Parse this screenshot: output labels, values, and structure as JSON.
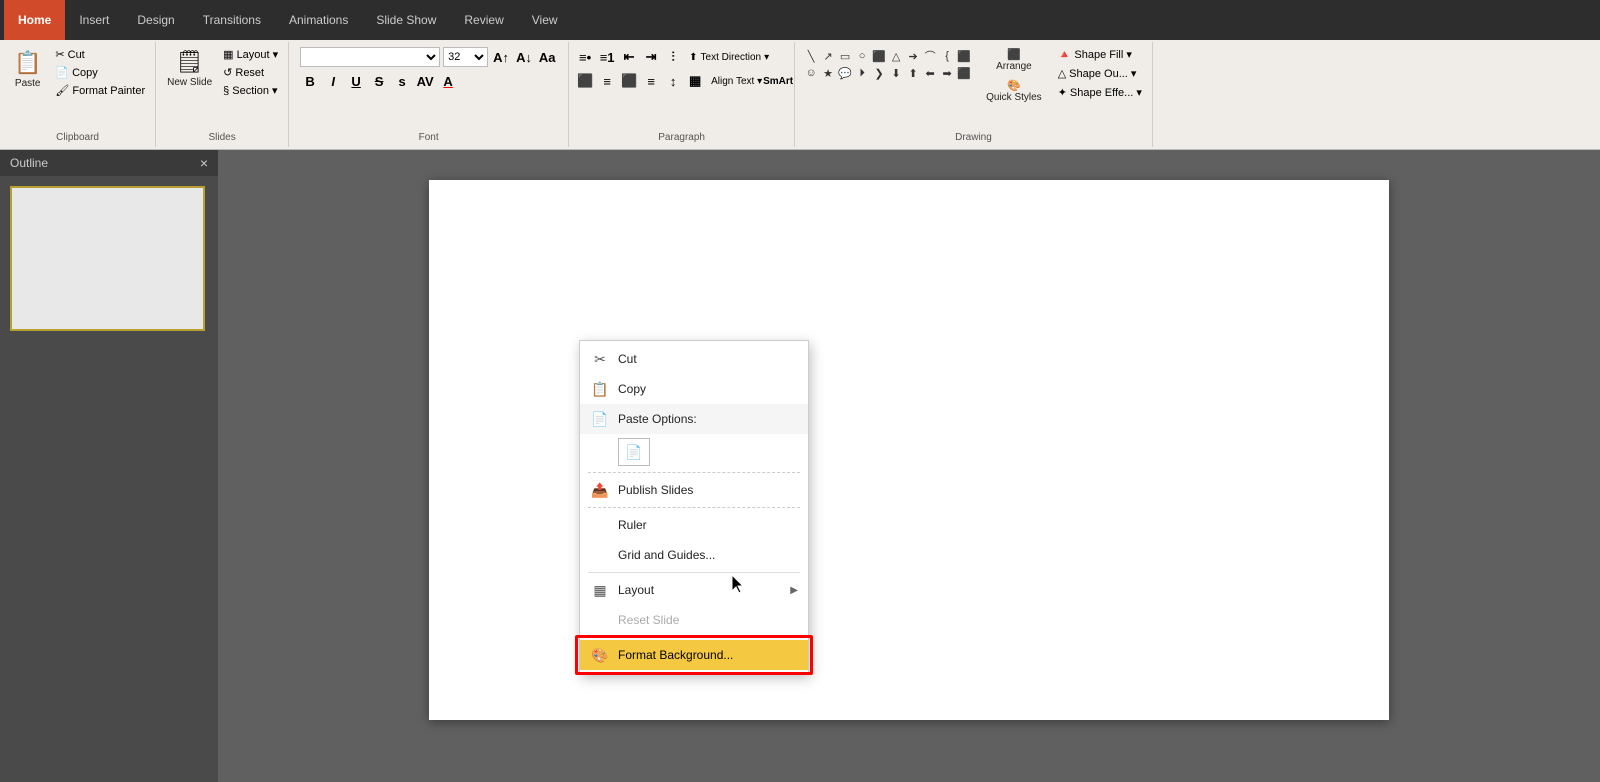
{
  "tabs": {
    "items": [
      "Home",
      "Insert",
      "Design",
      "Transitions",
      "Animations",
      "Slide Show",
      "Review",
      "View"
    ],
    "active": "Home"
  },
  "ribbon": {
    "clipboard": {
      "label": "Clipboard",
      "cut": "Cut",
      "copy": "Copy",
      "paste": "Paste",
      "format_painter": "Format Painter"
    },
    "slides": {
      "label": "Slides",
      "new_slide": "New Slide",
      "layout": "Layout",
      "reset": "Reset",
      "section": "Section"
    },
    "font": {
      "label": "Font",
      "face": "",
      "size": "32",
      "bold": "B",
      "italic": "I",
      "underline": "U",
      "strikethrough": "S",
      "shadow": "s",
      "increase": "A",
      "decrease": "A",
      "change_case": "Aa",
      "color": "A"
    },
    "paragraph": {
      "label": "Paragraph",
      "align_text": "Align Text ▾",
      "text_direction": "Text Direction",
      "convert_smartart": "Convert to SmartArt"
    },
    "drawing": {
      "label": "Drawing",
      "arrange": "Arrange",
      "quick_styles": "Quick Styles",
      "shape_fill": "Shape Fill",
      "shape_outline": "Shape Ou...",
      "shape_effects": "Shape Effe..."
    }
  },
  "sidebar": {
    "label": "Outline",
    "close": "×"
  },
  "context_menu": {
    "items": [
      {
        "id": "cut",
        "label": "Cut",
        "icon": "✂",
        "has_icon": true
      },
      {
        "id": "copy",
        "label": "Copy",
        "icon": "📋",
        "has_icon": true
      },
      {
        "id": "paste_options",
        "label": "Paste Options:",
        "icon": "📄",
        "has_icon": true,
        "is_paste": true
      },
      {
        "id": "publish_slides",
        "label": "Publish Slides",
        "icon": "📤",
        "has_icon": true
      },
      {
        "id": "ruler",
        "label": "Ruler",
        "has_icon": false
      },
      {
        "id": "grid_guides",
        "label": "Grid and Guides...",
        "has_icon": false
      },
      {
        "id": "layout",
        "label": "Layout",
        "has_icon": true,
        "has_submenu": true,
        "icon": "▦"
      },
      {
        "id": "reset_slide",
        "label": "Reset Slide",
        "has_icon": false,
        "disabled": true
      },
      {
        "id": "format_background",
        "label": "Format Background...",
        "has_icon": true,
        "icon": "🎨",
        "highlighted": true
      }
    ]
  }
}
